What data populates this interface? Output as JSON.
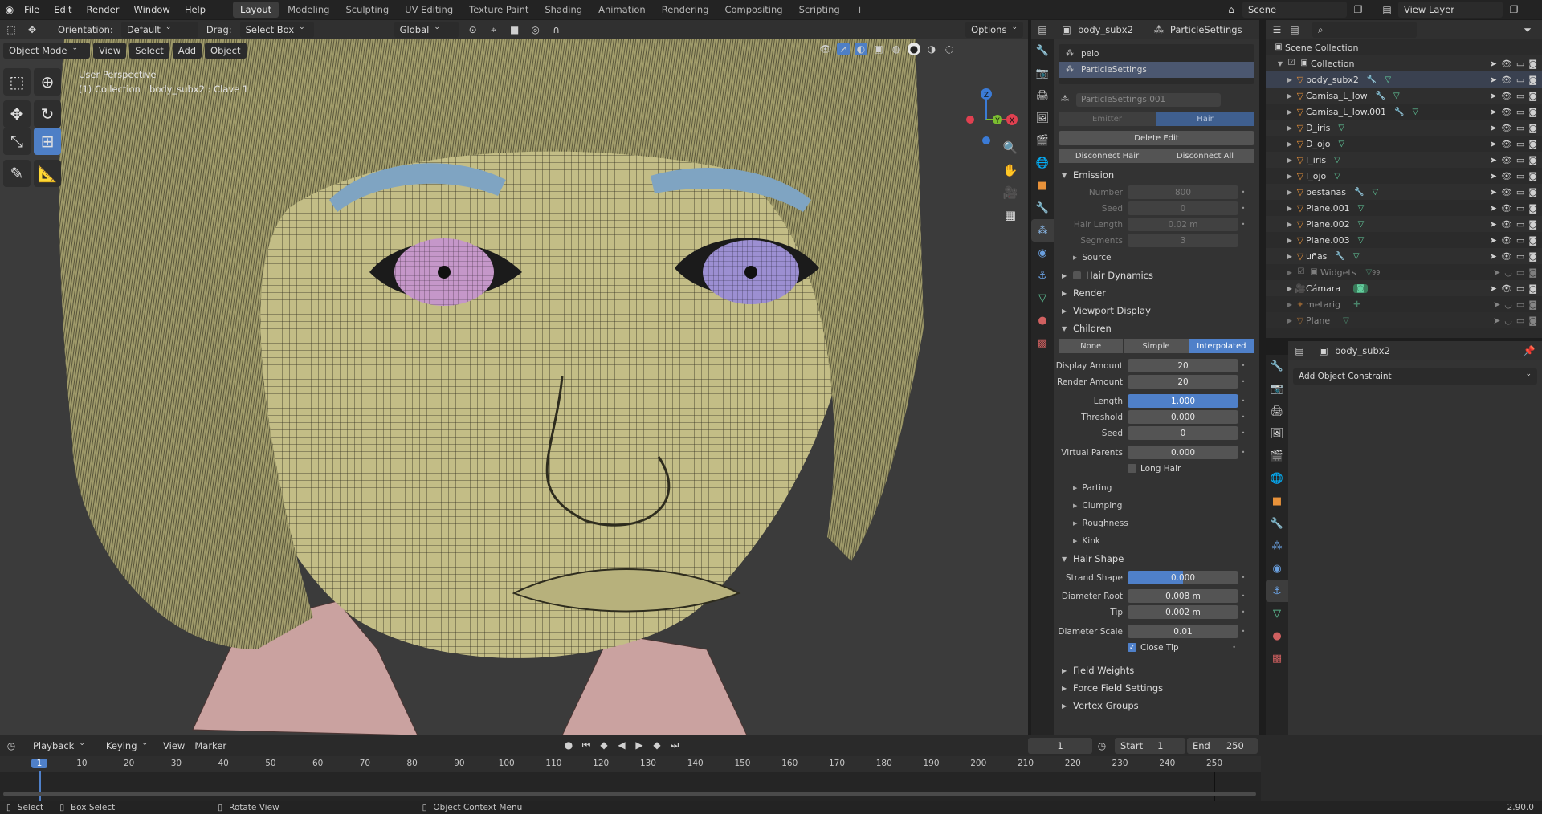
{
  "topbar": {
    "menus": [
      "File",
      "Edit",
      "Render",
      "Window",
      "Help"
    ],
    "workspaces": [
      "Layout",
      "Modeling",
      "Sculpting",
      "UV Editing",
      "Texture Paint",
      "Shading",
      "Animation",
      "Rendering",
      "Compositing",
      "Scripting"
    ],
    "active_workspace": "Layout",
    "add_tab": "+",
    "scene": "Scene",
    "view_layer": "View Layer"
  },
  "vp_header": {
    "orientation_label": "Orientation:",
    "orientation": "Default",
    "drag_label": "Drag:",
    "drag": "Select Box",
    "transform": "Global",
    "options": "Options",
    "mode": "Object Mode",
    "menus": [
      "View",
      "Select",
      "Add",
      "Object"
    ]
  },
  "viewport": {
    "perspective": "User Perspective",
    "collection_info": "(1) Collection | body_subx2 : Clave 1",
    "gizmo": {
      "x": "X",
      "y": "Y",
      "z": "Z"
    }
  },
  "props": {
    "header_object": "body_subx2",
    "header_settings": "ParticleSettings",
    "slots": [
      "pelo",
      "ParticleSettings"
    ],
    "datablock": "ParticleSettings.001",
    "type_options": [
      "Emitter",
      "Hair"
    ],
    "active_type": "Hair",
    "delete_edit": "Delete Edit",
    "disconnect_hair": "Disconnect Hair",
    "disconnect_all": "Disconnect All",
    "emission": {
      "title": "Emission",
      "number_label": "Number",
      "number": "800",
      "seed_label": "Seed",
      "seed": "0",
      "hair_length_label": "Hair Length",
      "hair_length": "0.02 m",
      "segments_label": "Segments",
      "segments": "3"
    },
    "sections": {
      "source": "Source",
      "hair_dynamics": "Hair Dynamics",
      "render": "Render",
      "viewport_display": "Viewport Display",
      "children": "Children"
    },
    "children": {
      "modes": [
        "None",
        "Simple",
        "Interpolated"
      ],
      "active": "Interpolated",
      "display_amount_label": "Display Amount",
      "display_amount": "20",
      "render_amount_label": "Render Amount",
      "render_amount": "20",
      "length_label": "Length",
      "length": "1.000",
      "threshold_label": "Threshold",
      "threshold": "0.000",
      "seed_label": "Seed",
      "seed": "0",
      "virtual_parents_label": "Virtual Parents",
      "virtual_parents": "0.000",
      "long_hair": "Long Hair",
      "subs": [
        "Parting",
        "Clumping",
        "Roughness",
        "Kink"
      ]
    },
    "hair_shape": {
      "title": "Hair Shape",
      "strand_shape_label": "Strand Shape",
      "strand_shape": "0.000",
      "diameter_root_label": "Diameter Root",
      "diameter_root": "0.008 m",
      "tip_label": "Tip",
      "tip": "0.002 m",
      "diameter_scale_label": "Diameter Scale",
      "diameter_scale": "0.01",
      "close_tip": "Close Tip"
    },
    "bottom_sections": [
      "Field Weights",
      "Force Field Settings",
      "Vertex Groups"
    ]
  },
  "outliner": {
    "root": "Scene Collection",
    "collection": "Collection",
    "items": [
      "body_subx2",
      "Camisa_L_low",
      "Camisa_L_low.001",
      "D_iris",
      "D_ojo",
      "I_iris",
      "I_ojo",
      "pestañas",
      "Plane.001",
      "Plane.002",
      "Plane.003",
      "uñas"
    ],
    "widgets": "Widgets",
    "widgets_count": "99",
    "camera": "Cámara",
    "metarig": "metarig",
    "plane": "Plane"
  },
  "constraints": {
    "object": "body_subx2",
    "add": "Add Object Constraint"
  },
  "timeline": {
    "menus": [
      "Playback",
      "Keying",
      "View",
      "Marker"
    ],
    "current_frame": "1",
    "start_label": "Start",
    "start": "1",
    "end_label": "End",
    "end": "250",
    "ticks": [
      "1",
      "10",
      "20",
      "30",
      "40",
      "50",
      "60",
      "70",
      "80",
      "90",
      "100",
      "110",
      "120",
      "130",
      "140",
      "150",
      "160",
      "170",
      "180",
      "190",
      "200",
      "210",
      "220",
      "230",
      "240",
      "250"
    ]
  },
  "status": {
    "select": "Select",
    "box_select": "Box Select",
    "rotate_view": "Rotate View",
    "context_menu": "Object Context Menu",
    "version": "2.90.0"
  }
}
